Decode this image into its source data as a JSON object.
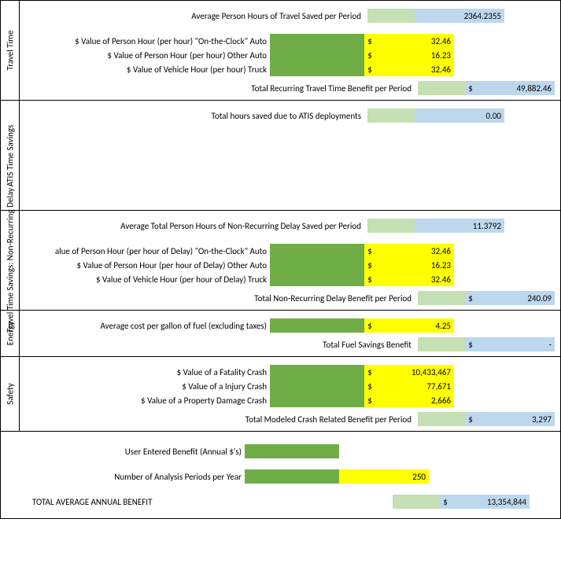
{
  "travel_time": {
    "title": "Travel Time",
    "avg_label": "Average Person Hours of Travel Saved per Period",
    "avg_value": "2364.2355",
    "rows": [
      {
        "label": "$ Value of Person Hour (per hour) \"On-the-Clock\" Auto",
        "dollar": "$",
        "value": "32.46"
      },
      {
        "label": "$ Value of Person Hour (per hour) Other Auto",
        "dollar": "$",
        "value": "16.23"
      },
      {
        "label": "$ Value of Vehicle Hour (per hour) Truck",
        "dollar": "$",
        "value": "32.46"
      }
    ],
    "total_label": "Total Recurring Travel Time Benefit per Period",
    "total_dollar": "$",
    "total_value": "49,882.46"
  },
  "atis": {
    "title": "ATIS Time Savings",
    "row_label": "Total hours saved due to ATIS deployments",
    "row_value": "0.00"
  },
  "nonrec": {
    "title": "Travel Time Savings:  Non-Recurring Delay",
    "avg_label": "Average Total Person Hours of Non-Recurring Delay Saved per Period",
    "avg_value": "11.3792",
    "rows": [
      {
        "label": "alue of Person Hour (per hour of Delay) \"On-the-Clock\" Auto",
        "dollar": "$",
        "value": "32.46"
      },
      {
        "label": "$ Value of Person Hour (per hour of Delay) Other Auto",
        "dollar": "$",
        "value": "16.23"
      },
      {
        "label": "$ Value of Vehicle Hour (per hour of Delay) Truck",
        "dollar": "$",
        "value": "32.46"
      }
    ],
    "total_label": "Total Non-Recurring Delay Benefit per Period",
    "total_dollar": "$",
    "total_value": "240.09"
  },
  "energy": {
    "title": "Energy",
    "row_label": "Average cost per gallon of fuel (excluding taxes)",
    "row_dollar": "$",
    "row_value": "4.25",
    "total_label": "Total Fuel Savings Benefit",
    "total_dollar": "$",
    "total_value": "-"
  },
  "safety": {
    "title": "Safety",
    "rows": [
      {
        "label": "$ Value of a Fatality Crash",
        "dollar": "$",
        "value": "10,433,467"
      },
      {
        "label": "$ Value of a Injury Crash",
        "dollar": "$",
        "value": "77,671"
      },
      {
        "label": "$ Value of a Property Damage Crash",
        "dollar": "$",
        "value": "2,666"
      }
    ],
    "total_label": "Total Modeled Crash Related Benefit per Period",
    "total_dollar": "$",
    "total_value": "3,297"
  },
  "bottom": {
    "user_benefit_label": "User Entered Benefit (Annual $'s)",
    "periods_label": "Number of Analysis Periods per Year",
    "periods_value": "250",
    "total_label": "TOTAL AVERAGE ANNUAL BENEFIT",
    "total_dollar": "$",
    "total_value": "13,354,844"
  }
}
